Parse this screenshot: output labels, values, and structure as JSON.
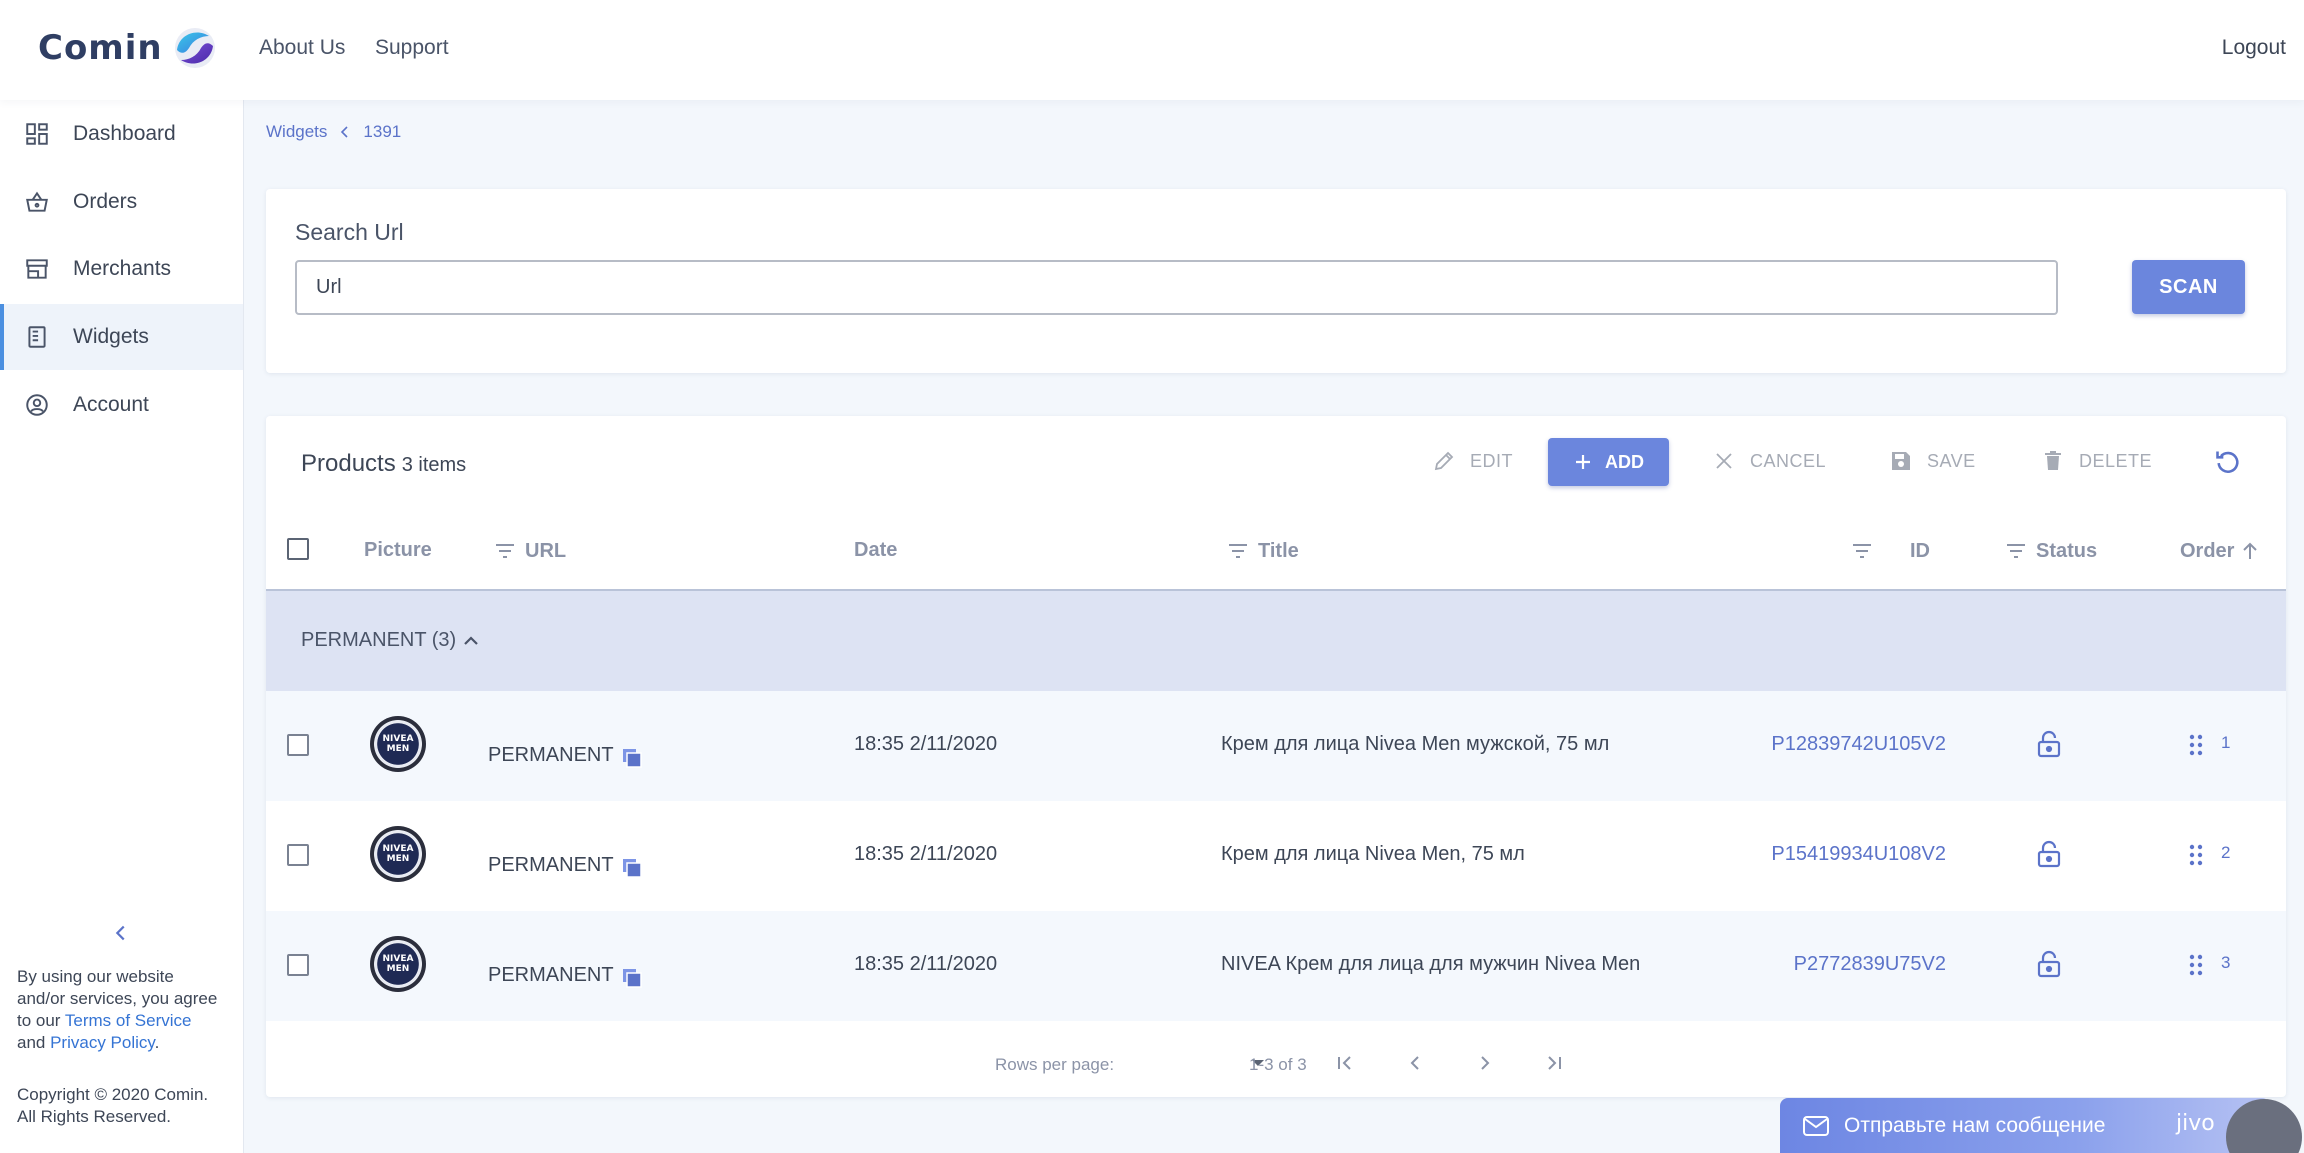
{
  "header": {
    "logo": "Comin",
    "nav": [
      "About Us",
      "Support"
    ],
    "logout": "Logout"
  },
  "sidebar": {
    "items": [
      {
        "label": "Dashboard",
        "icon": "dashboard-icon",
        "active": false
      },
      {
        "label": "Orders",
        "icon": "basket-icon",
        "active": false
      },
      {
        "label": "Merchants",
        "icon": "store-icon",
        "active": false
      },
      {
        "label": "Widgets",
        "icon": "widget-icon",
        "active": true
      },
      {
        "label": "Account",
        "icon": "account-icon",
        "active": false
      }
    ],
    "legal": {
      "prefix": "By using our website and/or services, you agree to our ",
      "terms": "Terms of Service",
      "and": " and ",
      "privacy": "Privacy Policy",
      "suffix": "."
    },
    "copyright": "Copyright © 2020 Comin. All Rights Reserved."
  },
  "breadcrumb": {
    "parent": "Widgets",
    "current": "1391"
  },
  "search": {
    "label": "Search Url",
    "placeholder": "Url",
    "button": "SCAN"
  },
  "products": {
    "title": "Products",
    "count": "3 items",
    "toolbar": {
      "edit": "EDIT",
      "add": "ADD",
      "cancel": "CANCEL",
      "save": "SAVE",
      "delete": "DELETE"
    },
    "columns": {
      "picture": "Picture",
      "url": "URL",
      "date": "Date",
      "title": "Title",
      "id": "ID",
      "status": "Status",
      "order": "Order"
    },
    "group": "PERMANENT (3)",
    "rows": [
      {
        "url": "PERMANENT",
        "date": "18:35 2/11/2020",
        "title": "Крем для лица Nivea Men мужской, 75 мл",
        "id": "P12839742U105V2",
        "order": "1"
      },
      {
        "url": "PERMANENT",
        "date": "18:35 2/11/2020",
        "title": "Крем для лица Nivea Men, 75 мл",
        "id": "P15419934U108V2",
        "order": "2"
      },
      {
        "url": "PERMANENT",
        "date": "18:35 2/11/2020",
        "title": "NIVEA Крем для лица для мужчин Nivea Men",
        "id": "P2772839U75V2",
        "order": "3"
      }
    ],
    "footer": {
      "rows_per_page": "Rows per page:",
      "range": "1-3 of 3"
    }
  },
  "chat": {
    "message": "Отправьте нам сообщение",
    "brand": "jivo"
  },
  "thumb_text": [
    "NIVEA",
    "MEN"
  ],
  "colors": {
    "accent": "#6b86dd",
    "link": "#5b73c9",
    "group_bg": "#dde3f3"
  }
}
